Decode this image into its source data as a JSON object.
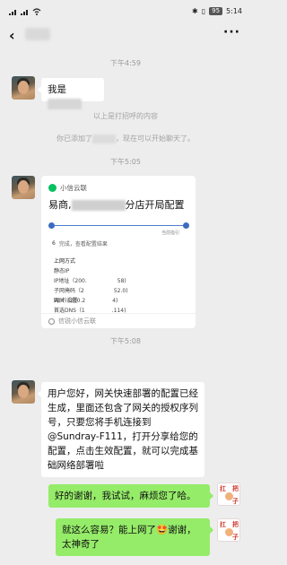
{
  "status": {
    "time": "5:14",
    "battery": "95"
  },
  "chat": {
    "more_icon": "more-dots-icon",
    "messages": [
      {
        "type": "time",
        "text": "下午4:59"
      },
      {
        "type": "text_left",
        "text": "我是"
      },
      {
        "type": "system",
        "text": "以上是打招呼的内容"
      },
      {
        "type": "system_added",
        "prefix": "你已添加了",
        "suffix": "，现在可以开始聊天了。"
      },
      {
        "type": "time",
        "text": "下午5:05"
      },
      {
        "type": "card",
        "source": "小信云联",
        "title_prefix": "易商,",
        "title_suffix": "分店开局配置",
        "pointer_label": "当前指引",
        "step_num": "6",
        "step_text": "完成，查看配置结果",
        "config_heading": "上网方式",
        "config_lines": [
          "静态IP",
          "IP地址（200.",
          "子网掩码（2",
          "网关（200.2",
          "首选DNS（1"
        ],
        "config_values": [
          "58)",
          "52.0)",
          "4)",
          ".114)"
        ],
        "wifi_label": "Wi-Fi设置",
        "footer": "信锐小信云联"
      },
      {
        "type": "time",
        "text": "下午5:08"
      },
      {
        "type": "text_left",
        "text": "用户您好，网关快速部署的配置已经生成，里面还包含了网关的授权序列号，只要您将手机连接到@Sundray-F111，打开分享给您的配置，点击生效配置，就可以完成基础网络部署啦"
      },
      {
        "type": "text_right",
        "text": "好的谢谢，我试试，麻烦您了哈。"
      },
      {
        "type": "text_right",
        "text": "就这么容易？能上网了🤩谢谢，太神奇了"
      }
    ]
  },
  "avatars": {
    "right_label": [
      "扛",
      "把",
      "子"
    ]
  }
}
